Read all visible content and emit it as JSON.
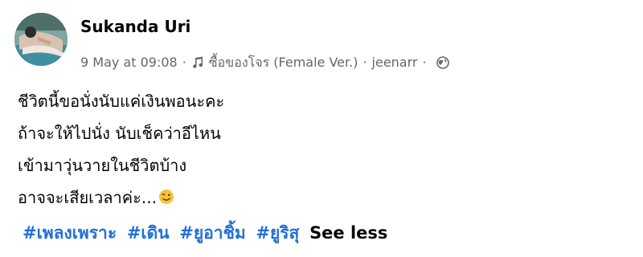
{
  "author": {
    "name": "Sukanda Uri"
  },
  "meta": {
    "date": "9 May at 09:08",
    "separator": "·",
    "song_title": "ซื้อของโจร (Female Ver.)",
    "artist": "jeenarr",
    "icons": {
      "music": "music-note-icon",
      "privacy": "globe-icon"
    }
  },
  "post": {
    "lines": [
      "ชีวิตนี้ขอนั่งนับแค่เงินพอนะคะ",
      "ถ้าจะให้ไปนั่ง นับเช็คว่าอีไหน",
      "เข้ามาวุ่นวายในชีวิตบ้าง",
      "อาจจะเสียเวลาค่ะ..."
    ],
    "emoji": "winking-face-emoji"
  },
  "tags": [
    "#เพลงเพราะ",
    "#เดิน",
    "#ยูอาชิ้ม",
    "#ยูริสุ"
  ],
  "see_less_label": "See less",
  "colors": {
    "hashtag": "#216fdb",
    "meta_text": "#65676b",
    "body_text": "#050505"
  }
}
